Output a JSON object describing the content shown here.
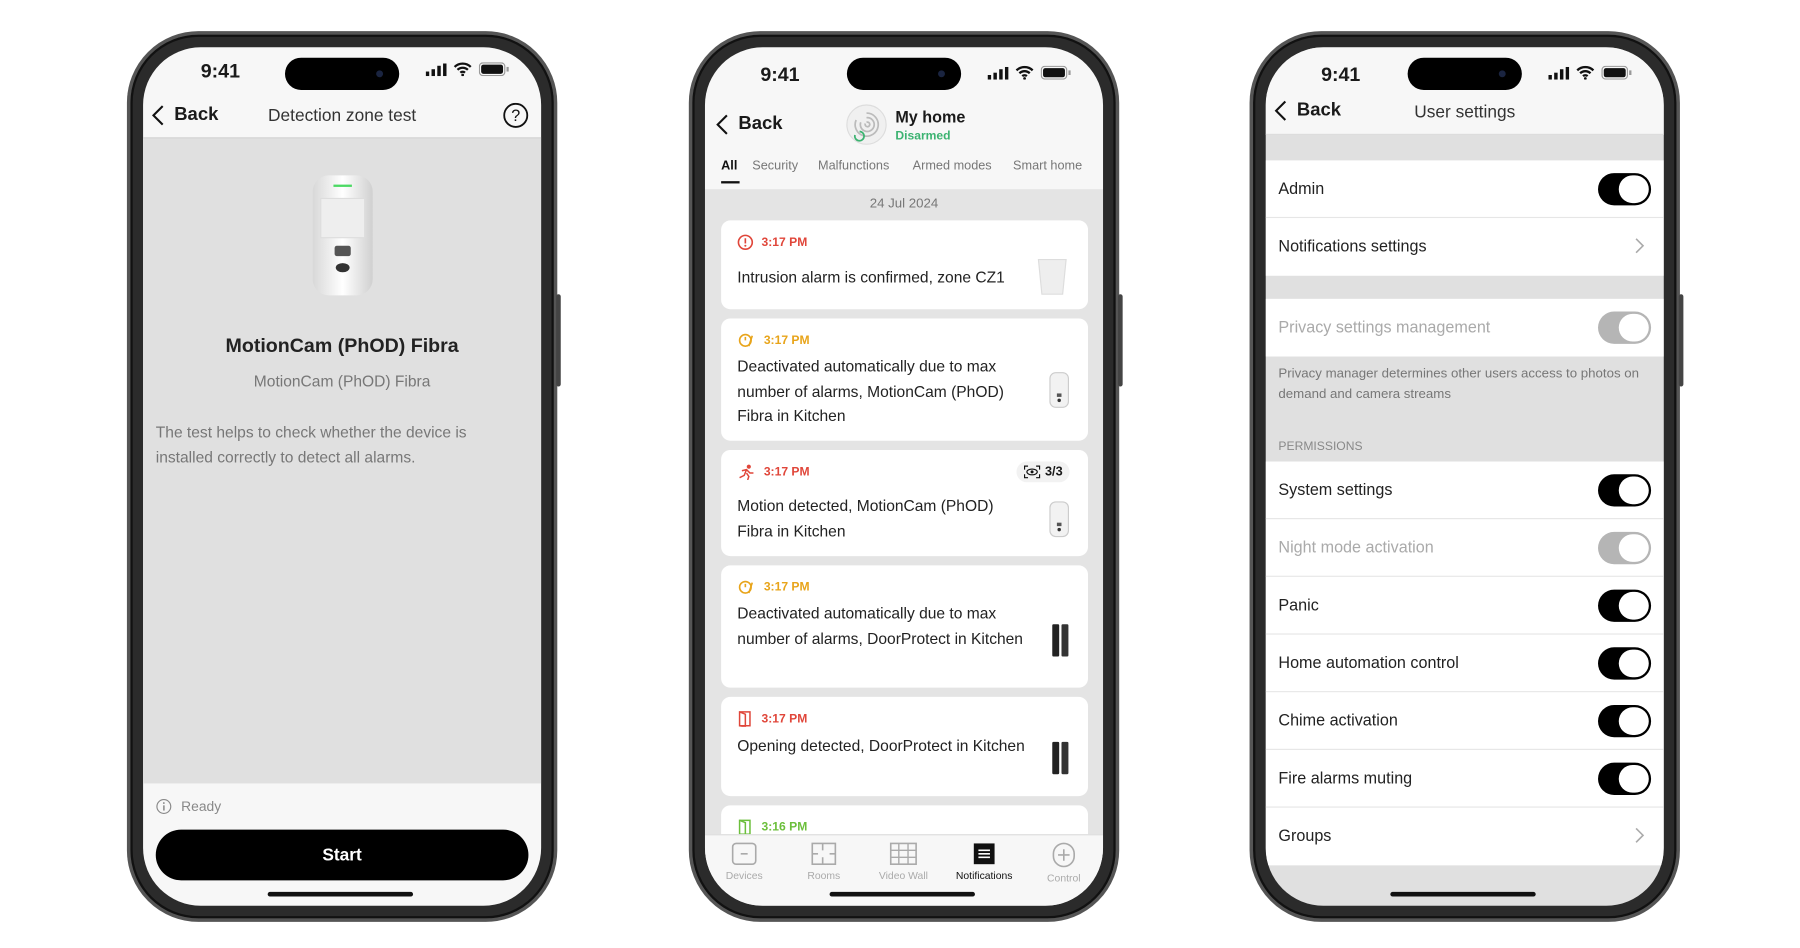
{
  "status_bar": {
    "time": "9:41"
  },
  "phone1": {
    "back_label": "Back",
    "title": "Detection zone test",
    "device_name": "MotionCam (PhOD) Fibra",
    "device_model": "MotionCam (PhOD) Fibra",
    "description": "The test helps to check whether the device is installed correctly to detect all alarms.",
    "status": "Ready",
    "start_label": "Start"
  },
  "phone2": {
    "back_label": "Back",
    "hub_name": "My home",
    "hub_status": "Disarmed",
    "tabs": [
      {
        "label": "All",
        "active": true
      },
      {
        "label": "Security"
      },
      {
        "label": "Malfunctions"
      },
      {
        "label": "Armed modes"
      },
      {
        "label": "Smart home"
      }
    ],
    "date": "24 Jul 2024",
    "events": [
      {
        "time": "3:17 PM",
        "icon": "alert-circle-icon",
        "color": "#e0463a",
        "text": "Intrusion alarm is confirmed, zone CZ1",
        "device": "hub"
      },
      {
        "time": "3:17 PM",
        "icon": "siren-off-icon",
        "color": "#e8a41a",
        "text": "Deactivated automatically due to max number of alarms, MotionCam (PhOD) Fibra in Kitchen",
        "device": "motioncam"
      },
      {
        "time": "3:17 PM",
        "icon": "running-person-icon",
        "color": "#e0463a",
        "text": "Motion detected, MotionCam (PhOD) Fibra in Kitchen",
        "device": "motioncam",
        "badge": "3/3"
      },
      {
        "time": "3:17 PM",
        "icon": "siren-off-icon",
        "color": "#e8a41a",
        "text": "Deactivated automatically due to max number of alarms, DoorProtect in Kitchen",
        "device": "doorprotect"
      },
      {
        "time": "3:17 PM",
        "icon": "door-open-icon",
        "color": "#e0463a",
        "text": "Opening detected, DoorProtect in Kitchen",
        "device": "doorprotect"
      },
      {
        "time": "3:16 PM",
        "icon": "door-closed-icon",
        "color": "#6cbf3c",
        "text": "",
        "device": ""
      }
    ],
    "nav": [
      {
        "label": "Devices"
      },
      {
        "label": "Rooms"
      },
      {
        "label": "Video Wall"
      },
      {
        "label": "Notifications",
        "active": true
      },
      {
        "label": "Control"
      }
    ],
    "accent_disarmed": "#3cb371"
  },
  "phone3": {
    "back_label": "Back",
    "title": "User settings",
    "admin": {
      "label": "Admin",
      "on": true
    },
    "notifications": {
      "label": "Notifications settings"
    },
    "privacy": {
      "label": "Privacy settings management",
      "on": true,
      "disabled": true
    },
    "privacy_note": "Privacy manager determines other users access to photos on demand and camera streams",
    "permissions_header": "PERMISSIONS",
    "permissions": [
      {
        "label": "System settings",
        "on": true
      },
      {
        "label": "Night mode activation",
        "on": true,
        "disabled": true
      },
      {
        "label": "Panic",
        "on": true
      },
      {
        "label": "Home automation control",
        "on": true
      },
      {
        "label": "Chime activation",
        "on": true
      },
      {
        "label": "Fire alarms muting",
        "on": true
      }
    ],
    "groups": {
      "label": "Groups"
    }
  }
}
